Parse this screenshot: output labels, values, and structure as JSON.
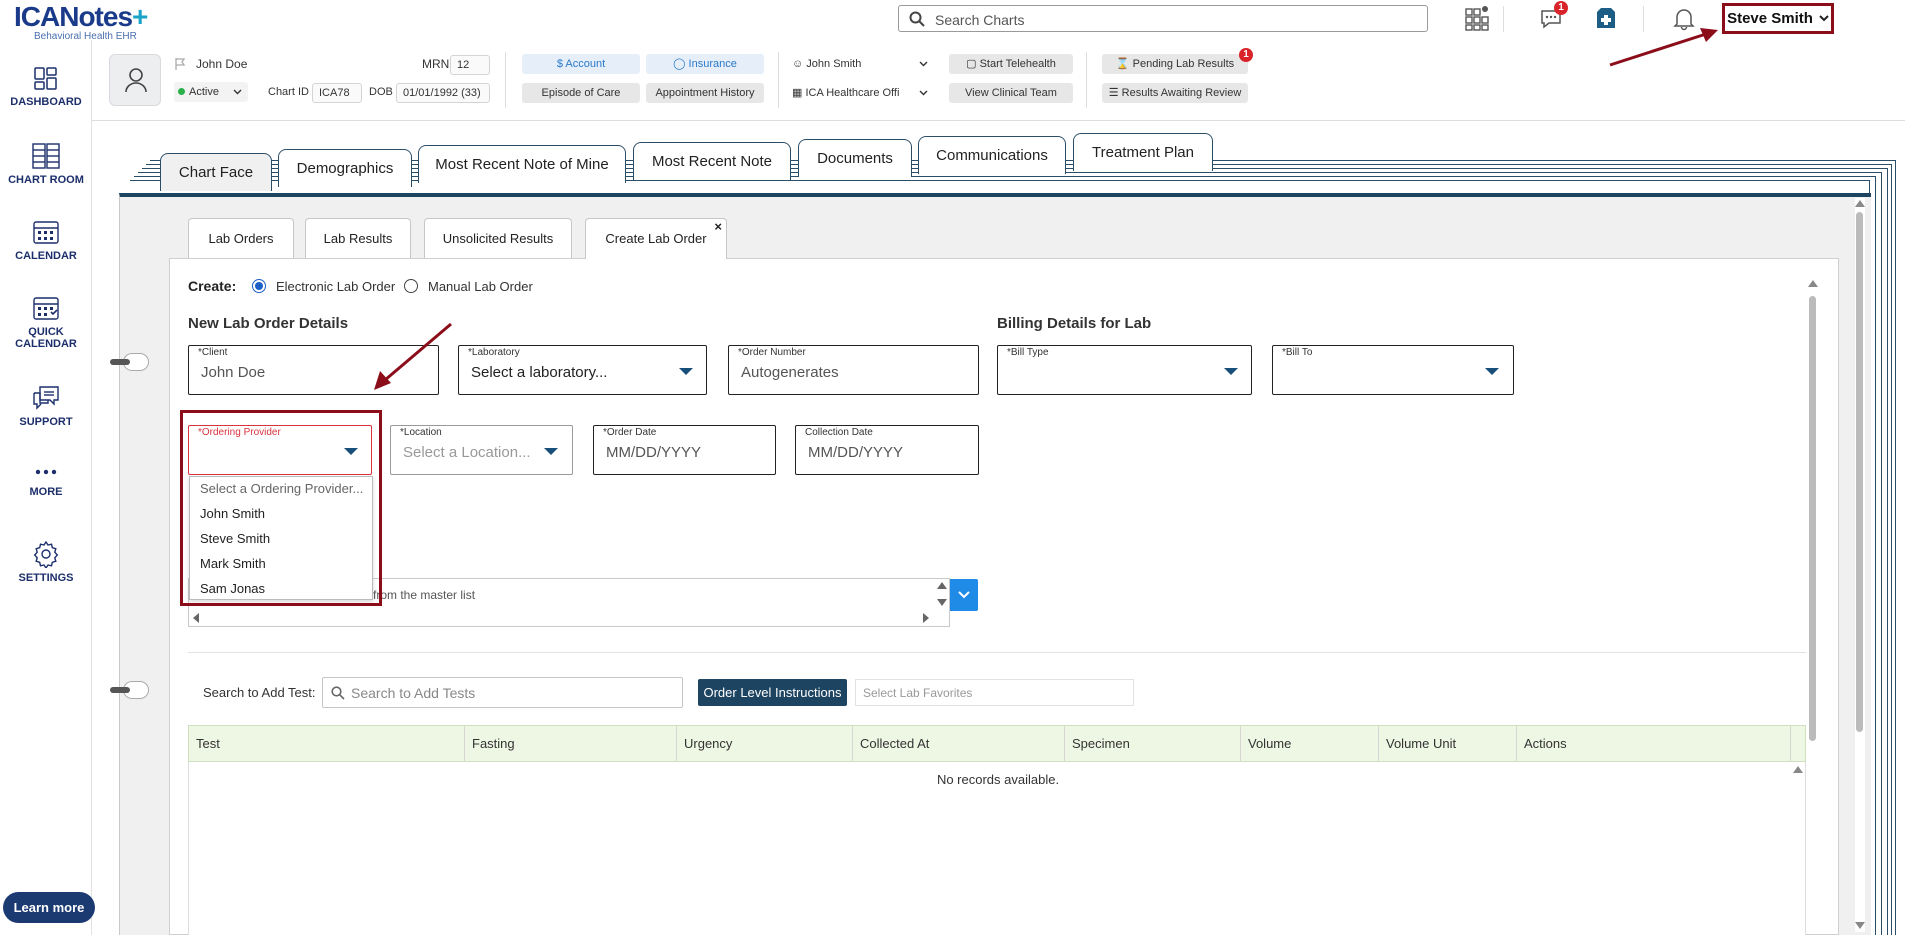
{
  "app": {
    "logo_text": "ICANotes",
    "logo_sub": "Behavioral Health EHR",
    "search_placeholder": "Search Charts",
    "messages_badge": "1",
    "user_name": "Steve Smith",
    "learn_more": "Learn more"
  },
  "nav": {
    "items": [
      {
        "label": "DASHBOARD",
        "icon": "dashboard-icon"
      },
      {
        "label": "CHART ROOM",
        "icon": "chart-room-icon"
      },
      {
        "label": "CALENDAR",
        "icon": "calendar-icon"
      },
      {
        "label_line1": "QUICK",
        "label_line2": "CALENDAR",
        "icon": "quick-calendar-icon"
      },
      {
        "label": "SUPPORT",
        "icon": "support-icon"
      },
      {
        "label": "MORE",
        "icon": "more-icon"
      },
      {
        "label": "SETTINGS",
        "icon": "gear-icon"
      }
    ]
  },
  "patient": {
    "name": "John Doe",
    "mrn_label": "MRN",
    "mrn": "12",
    "status": "Active",
    "chart_id_label": "Chart ID",
    "chart_id": "ICA78",
    "dob_label": "DOB",
    "dob": "01/01/1992 (33)",
    "account": "Account",
    "insurance": "Insurance",
    "episode_of_care": "Episode of Care",
    "appointment_history": "Appointment History",
    "provider": "John Smith",
    "office": "ICA Healthcare Offi",
    "start_telehealth": "Start Telehealth",
    "view_clinical_team": "View Clinical Team",
    "pending_lab_results": "Pending Lab Results",
    "pending_badge": "1",
    "results_awaiting_review": "Results Awaiting Review"
  },
  "main_tabs": [
    "Chart Face",
    "Demographics",
    "Most Recent Note of Mine",
    "Most Recent Note",
    "Documents",
    "Communications",
    "Treatment Plan"
  ],
  "sub_tabs": [
    "Lab Orders",
    "Lab Results",
    "Unsolicited Results",
    "Create Lab Order"
  ],
  "form": {
    "create_label": "Create:",
    "electronic": "Electronic Lab Order",
    "manual": "Manual Lab Order",
    "new_order_title": "New Lab Order Details",
    "billing_title": "Billing Details for Lab",
    "client_label": "*Client",
    "client_value": "John Doe",
    "laboratory_label": "*Laboratory",
    "laboratory_value": "Select a laboratory...",
    "order_number_label": "*Order Number",
    "order_number_value": "Autogenerates",
    "bill_type_label": "*Bill Type",
    "bill_to_label": "*Bill To",
    "ordering_provider_label": "*Ordering Provider",
    "location_label": "*Location",
    "location_value": "Select a Location...",
    "order_date_label": "*Order Date",
    "order_date_placeholder": "MM/DD/YYYY",
    "collection_date_label": "Collection Date",
    "collection_date_placeholder": "MM/DD/YYYY",
    "provider_options": [
      "Select a Ordering Provider...",
      "John Smith",
      "Steve Smith",
      "Mark Smith",
      "Sam Jonas"
    ],
    "diagnosis_text": "from the master list",
    "search_tests_label": "Search to Add Test:",
    "search_tests_placeholder": "Search to Add Tests",
    "order_level_instructions": "Order Level Instructions",
    "lab_favorites_placeholder": "Select Lab Favorites"
  },
  "grid": {
    "columns": [
      "Test",
      "Fasting",
      "Urgency",
      "Collected At",
      "Specimen",
      "Volume",
      "Volume Unit",
      "Actions"
    ],
    "empty_text": "No records available."
  },
  "colors": {
    "brand_navy": "#1d4461",
    "highlight": "#8b0d1a",
    "error": "#d9333f",
    "accent_blue": "#1f8be6"
  }
}
